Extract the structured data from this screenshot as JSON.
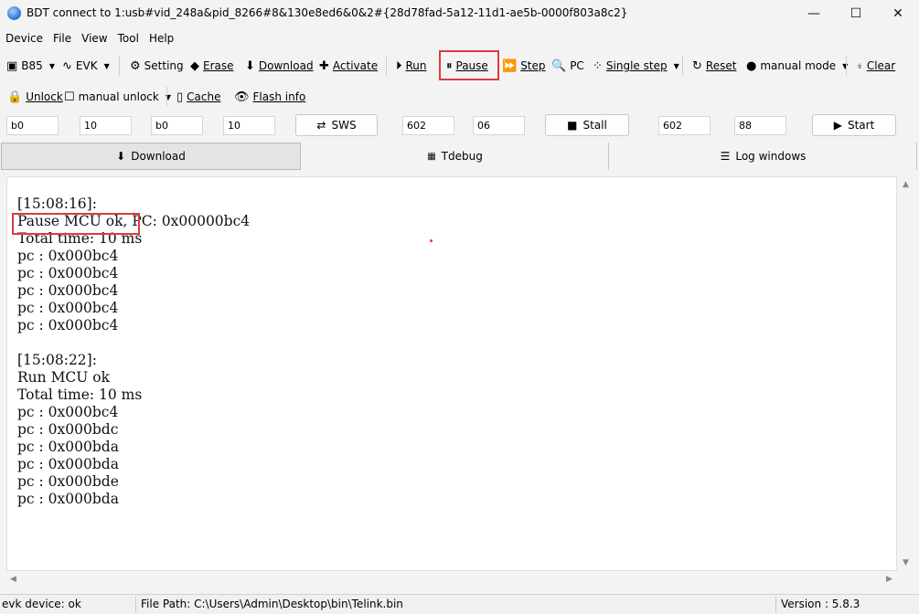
{
  "window": {
    "title": "BDT connect to 1:usb#vid_248a&pid_8266#8&130e8ed6&0&2#{28d78fad-5a12-11d1-ae5b-0000f803a8c2}",
    "minimize": "—",
    "maximize": "☐",
    "close": "✕"
  },
  "menu": [
    "Device",
    "File",
    "View",
    "Tool",
    "Help"
  ],
  "toolbar1": {
    "chip": "B85",
    "evk": "EVK",
    "setting": "Setting",
    "erase": "Erase",
    "download": "Download",
    "activate": "Activate",
    "run": "Run",
    "pause": "Pause",
    "step": "Step",
    "pc": "PC",
    "single_step": "Single step",
    "reset": "Reset",
    "manual_mode": "manual mode",
    "clear": "Clear"
  },
  "toolbar2": {
    "unlock": "Unlock",
    "manual_unlock": "manual unlock",
    "cache": "Cache",
    "flash_info": "Flash info"
  },
  "inputs": {
    "f1": "b0",
    "f2": "10",
    "f3": "b0",
    "f4": "10",
    "sws": "SWS",
    "f5": "602",
    "f6": "06",
    "stall": "Stall",
    "f7": "602",
    "f8": "88",
    "start": "Start"
  },
  "tabs": [
    "Download",
    "Tdebug",
    "Log windows"
  ],
  "log": {
    "l1": "[15:08:16]:",
    "l2a": "Pause MCU ok,",
    "l2b": " PC: 0x00000bc4",
    "l3": "Total time: 10 ms",
    "l4": "pc : 0x000bc4",
    "l5": "pc : 0x000bc4",
    "l6": "pc : 0x000bc4",
    "l7": "pc : 0x000bc4",
    "l8": "pc : 0x000bc4",
    "l9": "",
    "l10": "[15:08:22]:",
    "l11": "Run MCU ok",
    "l12": "Total time: 10 ms",
    "l13": "pc : 0x000bc4",
    "l14": "pc : 0x000bdc",
    "l15": "pc : 0x000bda",
    "l16": "pc : 0x000bda",
    "l17": "pc : 0x000bde",
    "l18": "pc : 0x000bda"
  },
  "status": {
    "device": "evk device: ok",
    "file_path": "File Path:  C:\\Users\\Admin\\Desktop\\bin\\Telink.bin",
    "version": "Version : 5.8.3"
  },
  "colors": {
    "highlight": "#e0393e",
    "window_bg": "#f3f3f3"
  }
}
